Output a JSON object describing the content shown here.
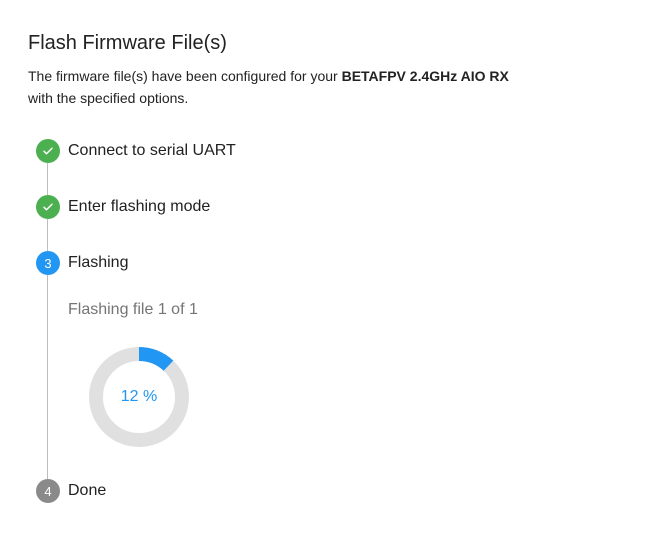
{
  "dialog": {
    "title": "Flash Firmware File(s)",
    "description_prefix": "The firmware file(s) have been configured for your ",
    "device_name": "BETAFPV 2.4GHz AIO RX",
    "description_suffix": "with the specified options."
  },
  "steps": [
    {
      "number": "1",
      "label": "Connect to serial UART",
      "status": "completed",
      "icon": "check-icon"
    },
    {
      "number": "2",
      "label": "Enter flashing mode",
      "status": "completed",
      "icon": "check-icon"
    },
    {
      "number": "3",
      "label": "Flashing",
      "status": "active"
    },
    {
      "number": "4",
      "label": "Done",
      "status": "pending"
    }
  ],
  "flashing": {
    "file_status": "Flashing file 1 of 1",
    "progress_percent": 12,
    "progress_label": "12 %"
  },
  "colors": {
    "completed": "#4caf50",
    "active": "#2196f3",
    "pending": "#8a8a8a",
    "track": "#e0e0e0"
  }
}
